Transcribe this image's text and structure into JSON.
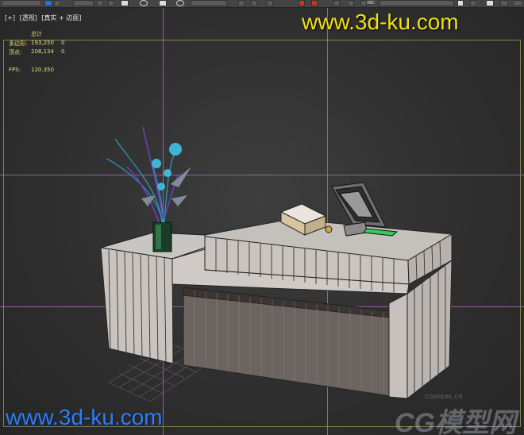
{
  "viewport": {
    "labels": [
      "[+]",
      "[透视]",
      "[真实 + 边面]"
    ],
    "stats": {
      "total_label": "总计",
      "polygons_label": "多边形:",
      "polygons_value": "193,250",
      "polygons_sel": "0",
      "vertices_label": "顶点:",
      "vertices_value": "208,134",
      "vertices_sel": "0",
      "fps_label": "FPS:",
      "fps_value": "120.350"
    }
  },
  "toolbar": {
    "abc_text": "ABC"
  },
  "watermarks": {
    "top": "www.3d-ku.com",
    "bottom": "www.3d-ku.com",
    "logo_small": "CGMODEL.CN",
    "logo_main": "CG模型网"
  },
  "colors": {
    "stats_text": "#e8dd7a",
    "guide_lines": "#b060c0",
    "watermark_top": "#f0e010",
    "watermark_bottom": "#2f7ff0"
  },
  "icons": [
    "select-arrow-icon",
    "rotate-icon",
    "snap-icon",
    "mirror-icon",
    "text-abc-icon"
  ]
}
